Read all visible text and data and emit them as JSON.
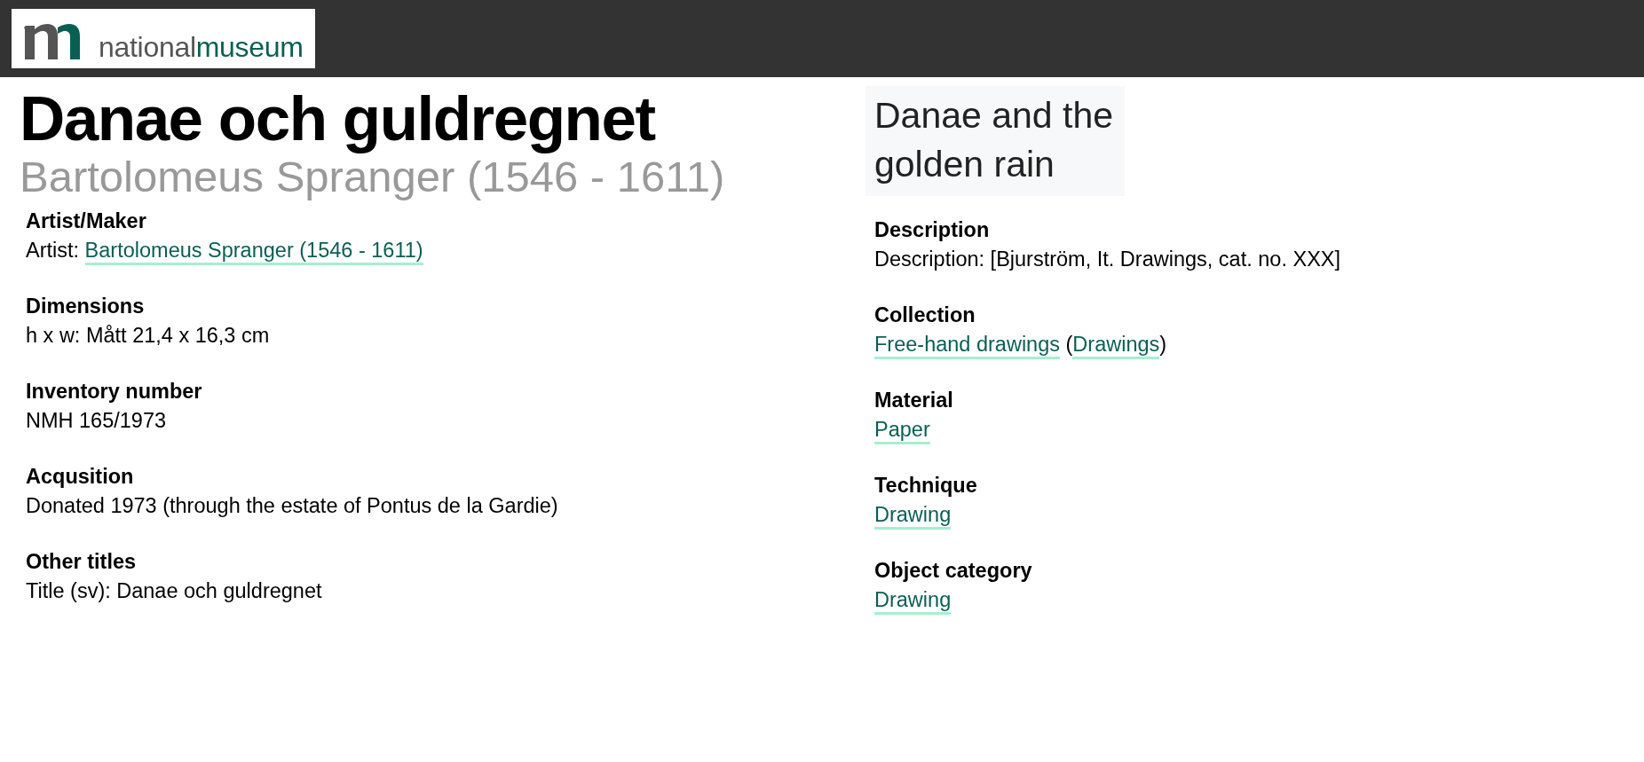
{
  "header": {
    "logo": {
      "word_1": "national",
      "word_2": "museum"
    }
  },
  "title": "Danae och guldregnet",
  "subtitle": "Bartolomeus Spranger (1546 - 1611)",
  "english_title": "Danae and the golden rain",
  "left_fields": [
    {
      "label": "Artist/Maker",
      "value": [
        {
          "kind": "text",
          "text": "Artist: "
        },
        {
          "kind": "link",
          "text": "Bartolomeus Spranger (1546 - 1611)"
        }
      ]
    },
    {
      "label": "Dimensions",
      "value": [
        {
          "kind": "text",
          "text": "h x w: Mått 21,4 x 16,3 cm"
        }
      ]
    },
    {
      "label": "Inventory number",
      "value": [
        {
          "kind": "text",
          "text": "NMH 165/1973"
        }
      ]
    },
    {
      "label": "Acqusition",
      "value": [
        {
          "kind": "text",
          "text": "Donated 1973 (through the estate of Pontus de la Gardie)"
        }
      ]
    },
    {
      "label": "Other titles",
      "value": [
        {
          "kind": "text",
          "text": "Title (sv): Danae och guldregnet"
        }
      ]
    }
  ],
  "right_fields": [
    {
      "label": "Description",
      "value": [
        {
          "kind": "text",
          "text": "Description: [Bjurström, It. Drawings, cat. no. XXX]"
        }
      ]
    },
    {
      "label": "Collection",
      "value": [
        {
          "kind": "link",
          "text": "Free-hand drawings"
        },
        {
          "kind": "text",
          "text": " ("
        },
        {
          "kind": "link",
          "text": "Drawings"
        },
        {
          "kind": "text",
          "text": ")"
        }
      ]
    },
    {
      "label": "Material",
      "value": [
        {
          "kind": "link",
          "text": "Paper"
        }
      ]
    },
    {
      "label": "Technique",
      "value": [
        {
          "kind": "link",
          "text": "Drawing"
        }
      ]
    },
    {
      "label": "Object category",
      "value": [
        {
          "kind": "link",
          "text": "Drawing"
        }
      ]
    }
  ]
}
